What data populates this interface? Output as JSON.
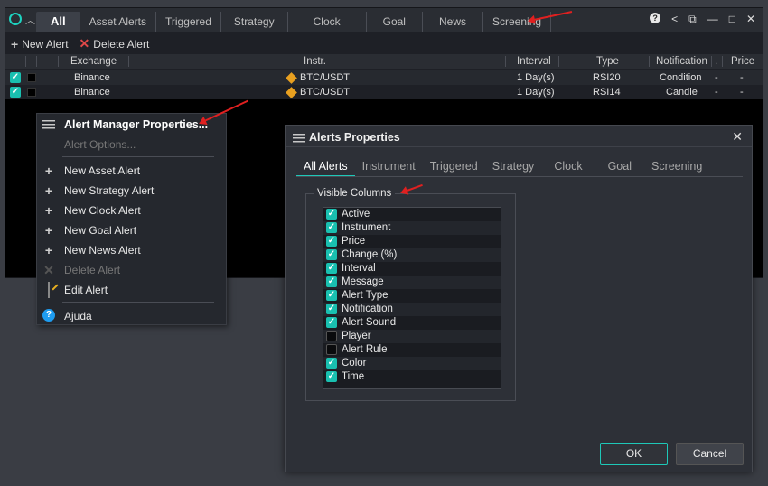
{
  "main": {
    "tabs": [
      "All",
      "Asset Alerts",
      "Triggered",
      "Strategy",
      "Clock",
      "Goal",
      "News",
      "Screening"
    ],
    "toolbar": {
      "new_alert": "New Alert",
      "delete_alert": "Delete Alert"
    },
    "columns": {
      "exchange": "Exchange",
      "instr": "Instr.",
      "interval": "Interval",
      "type": "Type",
      "notification": "Notification",
      "dot": ".",
      "price": "Price"
    },
    "rows": [
      {
        "exchange": "Binance",
        "instr": "BTC/USDT",
        "interval": "1 Day(s)",
        "type": "RSI20",
        "notification": "Condition",
        "dot": "-",
        "price": "-"
      },
      {
        "exchange": "Binance",
        "instr": "BTC/USDT",
        "interval": "1 Day(s)",
        "type": "RSI14",
        "notification": "Candle",
        "dot": "-",
        "price": "-"
      }
    ]
  },
  "context_menu": {
    "properties": "Alert Manager Properties...",
    "options": "Alert Options...",
    "new_asset": "New Asset Alert",
    "new_strategy": "New Strategy Alert",
    "new_clock": "New Clock Alert",
    "new_goal": "New Goal Alert",
    "new_news": "New News Alert",
    "delete": "Delete Alert",
    "edit": "Edit Alert",
    "help": "Ajuda"
  },
  "dialog": {
    "title": "Alerts Properties",
    "tabs": [
      "All Alerts",
      "Instrument",
      "Triggered",
      "Strategy",
      "Clock",
      "Goal",
      "Screening"
    ],
    "group_title": "Visible Columns",
    "columns": [
      {
        "label": "Active",
        "checked": true
      },
      {
        "label": "Instrument",
        "checked": true
      },
      {
        "label": "Price",
        "checked": true
      },
      {
        "label": "Change (%)",
        "checked": true
      },
      {
        "label": "Interval",
        "checked": true
      },
      {
        "label": "Message",
        "checked": true
      },
      {
        "label": "Alert Type",
        "checked": true
      },
      {
        "label": "Notification",
        "checked": true
      },
      {
        "label": "Alert Sound",
        "checked": true
      },
      {
        "label": "Player",
        "checked": false
      },
      {
        "label": "Alert Rule",
        "checked": false
      },
      {
        "label": "Color",
        "checked": true
      },
      {
        "label": "Time",
        "checked": true
      }
    ],
    "ok": "OK",
    "cancel": "Cancel"
  },
  "colors": {
    "accent": "#19c0b0",
    "annotation": "#e02020"
  }
}
